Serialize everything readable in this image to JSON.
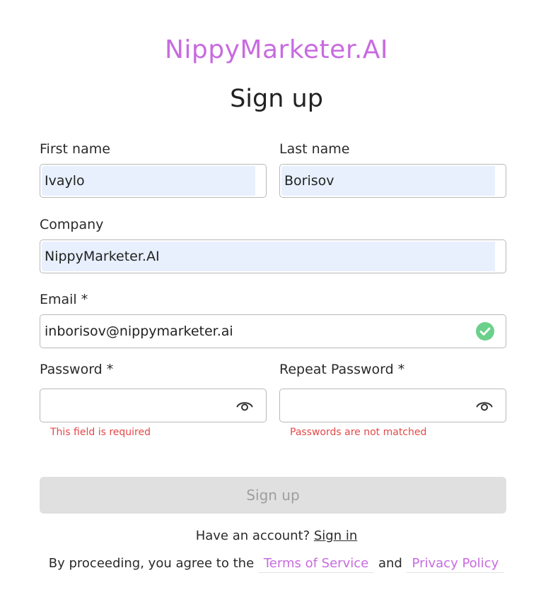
{
  "brand": {
    "logo": "NippyMarketer.AI"
  },
  "form": {
    "title": "Sign up",
    "first_name": {
      "label": "First name",
      "value": "Ivaylo"
    },
    "last_name": {
      "label": "Last name",
      "value": "Borisov"
    },
    "company": {
      "label": "Company",
      "value": "NippyMarketer.AI"
    },
    "email": {
      "label": "Email *",
      "value": "inborisov@nippymarketer.ai",
      "status_icon": "check-circle-icon",
      "status_color": "#6bd08b"
    },
    "password": {
      "label": "Password *",
      "value": "",
      "icon": "eye-icon",
      "error": "This field is required"
    },
    "repeat_password": {
      "label": "Repeat Password *",
      "value": "",
      "icon": "eye-icon",
      "error": "Passwords are not matched"
    },
    "submit_label": "Sign up"
  },
  "footer": {
    "have_account": "Have an account?",
    "sign_in": "Sign in",
    "agree_prefix": "By proceeding, you agree to the",
    "terms": "Terms of Service",
    "and": "and",
    "privacy": "Privacy Policy"
  },
  "colors": {
    "brand": "#c86be0",
    "error": "#e34848",
    "autofill": "#e8f0fe",
    "disabled_button": "#e0e0e0"
  }
}
